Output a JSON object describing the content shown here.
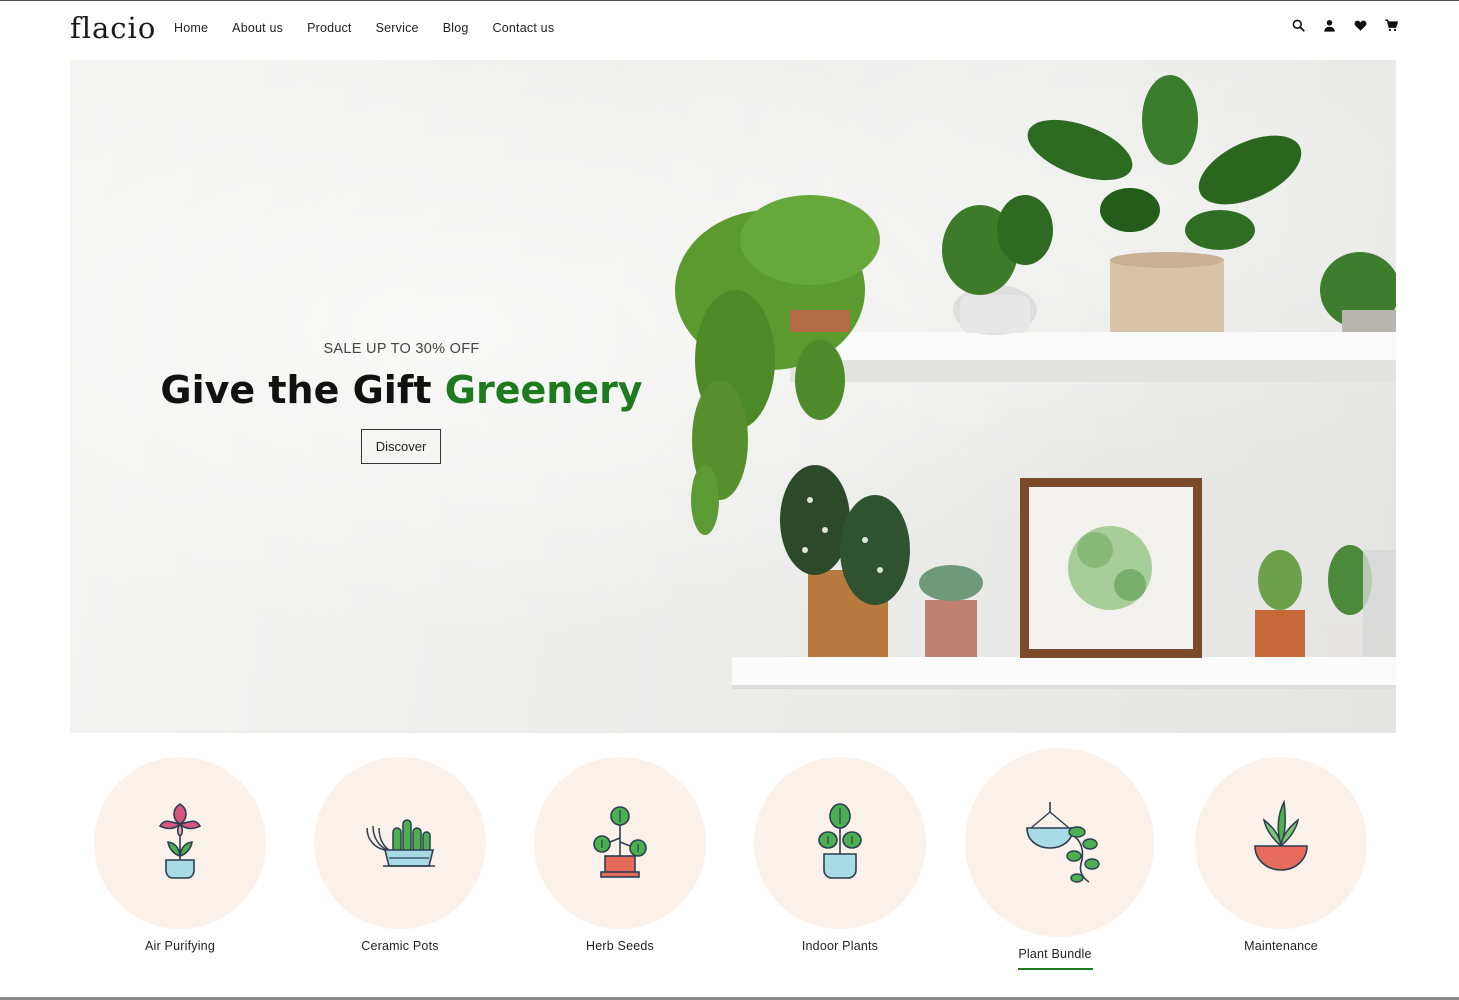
{
  "brand": {
    "logo": "flacio"
  },
  "nav": {
    "items": [
      "Home",
      "About us",
      "Product",
      "Service",
      "Blog",
      "Contact us"
    ]
  },
  "header_tools": [
    "search-icon",
    "user-icon",
    "heart-icon",
    "cart-icon"
  ],
  "hero": {
    "kicker": "SALE UP TO 30% OFF",
    "headline_main": "Give the Gift ",
    "headline_accent": "Greenery",
    "cta_label": "Discover",
    "accent_color": "#1e7a1e"
  },
  "categories": [
    {
      "label": "Air Purifying",
      "icon": "flower-pot-icon",
      "active": false
    },
    {
      "label": "Ceramic Pots",
      "icon": "cactus-planter-icon",
      "active": false
    },
    {
      "label": "Herb Seeds",
      "icon": "sprout-pot-icon",
      "active": false
    },
    {
      "label": "Indoor Plants",
      "icon": "indoor-plant-icon",
      "active": false
    },
    {
      "label": "Plant Bundle",
      "icon": "hanging-plant-icon",
      "active": true
    },
    {
      "label": "Maintenance",
      "icon": "aloe-bowl-icon",
      "active": false
    }
  ],
  "colors": {
    "circle_bg": "#fbf1eb",
    "accent": "#1e7a1e"
  }
}
